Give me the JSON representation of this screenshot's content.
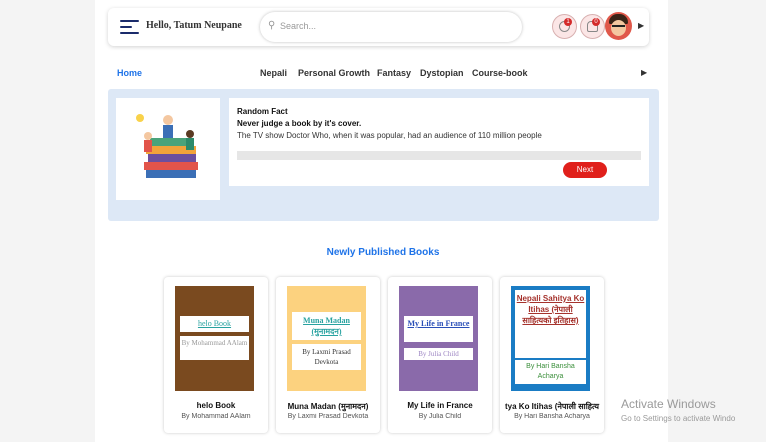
{
  "header": {
    "greeting": "Hello, Tatum Neupane",
    "search_placeholder": "Search...",
    "notification_badge_1": "1",
    "notification_badge_2": "0"
  },
  "nav": {
    "home": "Home",
    "categories": [
      "Nepali",
      "Personal Growth",
      "Fantasy",
      "Dystopian",
      "Course-book"
    ]
  },
  "fact": {
    "heading": "Random Fact",
    "subheading": "Never judge a book by it's cover.",
    "text": "The TV show Doctor Who, when it was popular, had an audience of 110 million people",
    "next_label": "Next"
  },
  "section_title": "Newly Published Books",
  "books": [
    {
      "cover_title": "helo Book",
      "cover_author": "By Mohammad AAlam",
      "title": "helo Book",
      "author": "By Mohammad AAlam",
      "cover_color": "#7a4a1f"
    },
    {
      "cover_title": "Muna Madan (मुनामदन)",
      "cover_author": "By Laxmi Prasad Devkota",
      "title": "Muna Madan (मुनामदन)",
      "author": "By Laxmi Prasad Devkota",
      "cover_color": "#fcd27f"
    },
    {
      "cover_title": "My Life in France",
      "cover_author": "By Julia Child",
      "title": "My Life in France",
      "author": "By Julia Child",
      "cover_color": "#8a6aaa"
    },
    {
      "cover_title": "Nepali Sahitya Ko Itihas (नेपाली साहित्यको इतिहास)",
      "cover_author": "By Hari Bansha Acharya",
      "title": "tya Ko Itihas (नेपाली साहित्य",
      "author": "By Hari Bansha Acharya",
      "cover_color": "#1a7cc4"
    }
  ],
  "watermark": {
    "line1": "Activate Windows",
    "line2": "Go to Settings to activate Windo"
  }
}
